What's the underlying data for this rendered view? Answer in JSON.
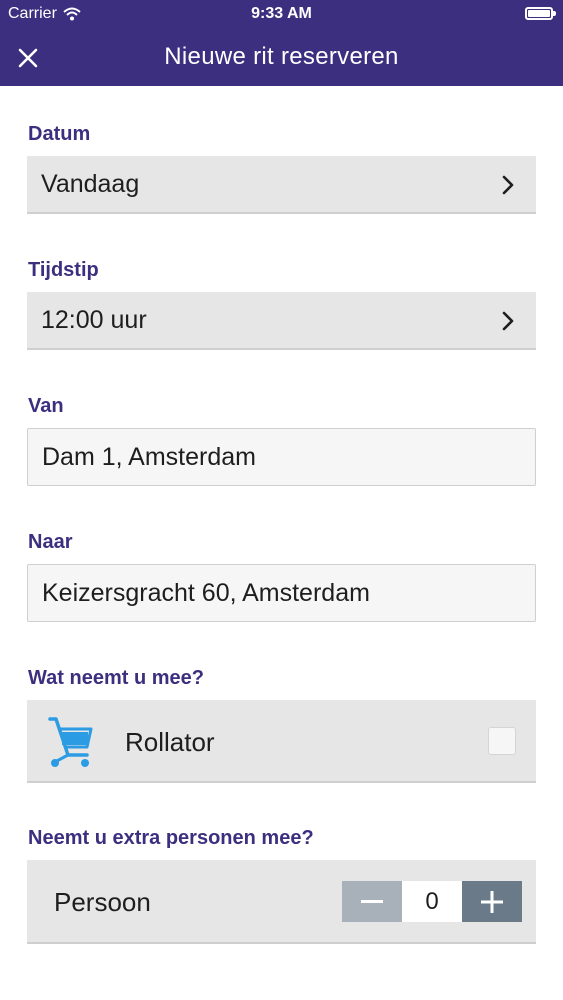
{
  "status_bar": {
    "carrier": "Carrier",
    "time": "9:33 AM"
  },
  "nav": {
    "title": "Nieuwe rit reserveren"
  },
  "form": {
    "datum": {
      "label": "Datum",
      "value": "Vandaag"
    },
    "tijdstip": {
      "label": "Tijdstip",
      "value": "12:00 uur"
    },
    "van": {
      "label": "Van",
      "value": "Dam 1, Amsterdam"
    },
    "naar": {
      "label": "Naar",
      "value": "Keizersgracht 60, Amsterdam"
    },
    "meenemen": {
      "label": "Wat neemt u mee?",
      "option": "Rollator",
      "checked": false
    },
    "extra": {
      "label": "Neemt u extra personen mee?",
      "item": "Persoon",
      "count": "0"
    }
  },
  "colors": {
    "brand": "#3c2f7f",
    "icon_blue": "#2b9be4",
    "field_bg": "#e6e6e6"
  },
  "icons": {
    "close": "close-icon",
    "chevron": "chevron-right-icon",
    "cart": "rollator-cart-icon",
    "wifi": "wifi-icon",
    "battery": "battery-icon"
  }
}
